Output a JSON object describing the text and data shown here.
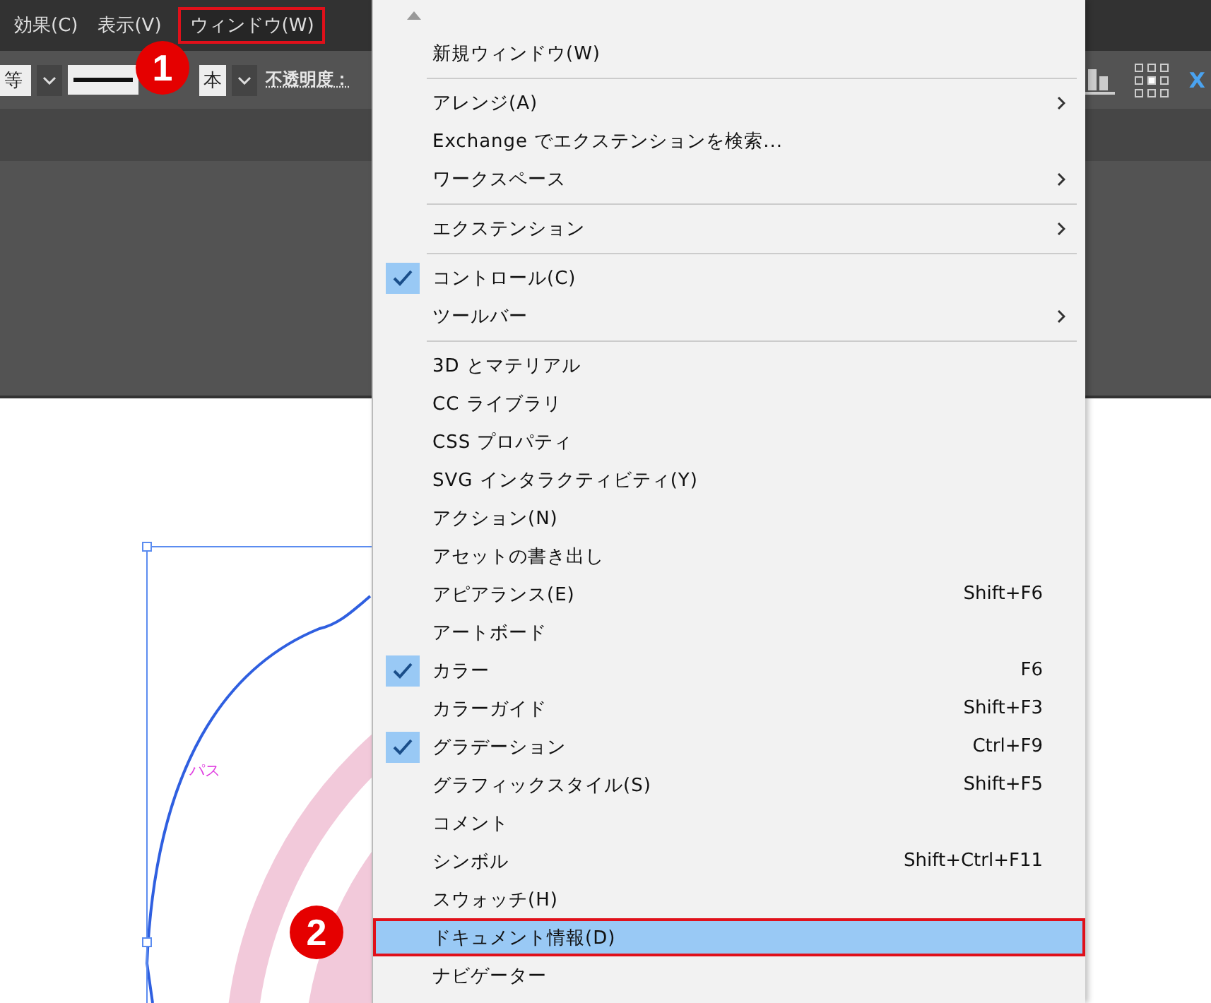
{
  "menubar": {
    "items": [
      {
        "label": "効果(C)",
        "selected": false
      },
      {
        "label": "表示(V)",
        "selected": false
      },
      {
        "label": "ウィンドウ(W)",
        "selected": true
      }
    ]
  },
  "toolbar": {
    "field_value": "等",
    "stroke_style": "本",
    "opacity_label": "不透明度：",
    "transform_label": "X"
  },
  "canvas": {
    "path_label": "パス"
  },
  "menu": {
    "items": [
      {
        "kind": "item",
        "label": "新規ウィンドウ(W)",
        "checked": false,
        "submenu": false,
        "selected": false
      },
      {
        "kind": "separator"
      },
      {
        "kind": "item",
        "label": "アレンジ(A)",
        "checked": false,
        "submenu": true,
        "selected": false
      },
      {
        "kind": "item",
        "label": "Exchange でエクステンションを検索...",
        "checked": false,
        "submenu": false,
        "selected": false
      },
      {
        "kind": "item",
        "label": "ワークスペース",
        "checked": false,
        "submenu": true,
        "selected": false
      },
      {
        "kind": "separator"
      },
      {
        "kind": "item",
        "label": "エクステンション",
        "checked": false,
        "submenu": true,
        "selected": false
      },
      {
        "kind": "separator"
      },
      {
        "kind": "item",
        "label": "コントロール(C)",
        "checked": true,
        "submenu": false,
        "selected": false
      },
      {
        "kind": "item",
        "label": "ツールバー",
        "checked": false,
        "submenu": true,
        "selected": false
      },
      {
        "kind": "separator"
      },
      {
        "kind": "item",
        "label": "3D とマテリアル",
        "checked": false,
        "submenu": false,
        "selected": false
      },
      {
        "kind": "item",
        "label": "CC ライブラリ",
        "checked": false,
        "submenu": false,
        "selected": false
      },
      {
        "kind": "item",
        "label": "CSS プロパティ",
        "checked": false,
        "submenu": false,
        "selected": false
      },
      {
        "kind": "item",
        "label": "SVG インタラクティビティ(Y)",
        "checked": false,
        "submenu": false,
        "selected": false
      },
      {
        "kind": "item",
        "label": "アクション(N)",
        "checked": false,
        "submenu": false,
        "selected": false
      },
      {
        "kind": "item",
        "label": "アセットの書き出し",
        "checked": false,
        "submenu": false,
        "selected": false
      },
      {
        "kind": "item",
        "label": "アピアランス(E)",
        "shortcut": "Shift+F6",
        "checked": false,
        "submenu": false,
        "selected": false
      },
      {
        "kind": "item",
        "label": "アートボード",
        "checked": false,
        "submenu": false,
        "selected": false
      },
      {
        "kind": "item",
        "label": "カラー",
        "shortcut": "F6",
        "checked": true,
        "submenu": false,
        "selected": false
      },
      {
        "kind": "item",
        "label": "カラーガイド",
        "shortcut": "Shift+F3",
        "checked": false,
        "submenu": false,
        "selected": false
      },
      {
        "kind": "item",
        "label": "グラデーション",
        "shortcut": "Ctrl+F9",
        "checked": true,
        "submenu": false,
        "selected": false
      },
      {
        "kind": "item",
        "label": "グラフィックスタイル(S)",
        "shortcut": "Shift+F5",
        "checked": false,
        "submenu": false,
        "selected": false
      },
      {
        "kind": "item",
        "label": "コメント",
        "checked": false,
        "submenu": false,
        "selected": false
      },
      {
        "kind": "item",
        "label": "シンボル",
        "shortcut": "Shift+Ctrl+F11",
        "checked": false,
        "submenu": false,
        "selected": false
      },
      {
        "kind": "item",
        "label": "スウォッチ(H)",
        "checked": false,
        "submenu": false,
        "selected": false
      },
      {
        "kind": "item",
        "label": "ドキュメント情報(D)",
        "checked": false,
        "submenu": false,
        "selected": true
      },
      {
        "kind": "item",
        "label": "ナビゲーター",
        "checked": false,
        "submenu": false,
        "selected": false
      }
    ]
  },
  "callouts": [
    {
      "number": "1"
    },
    {
      "number": "2"
    }
  ]
}
